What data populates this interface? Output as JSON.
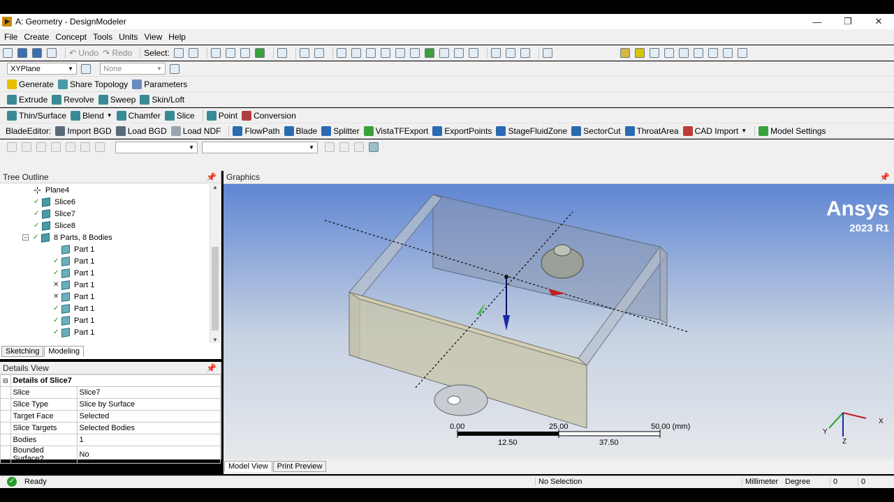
{
  "window": {
    "title": "A: Geometry - DesignModeler",
    "min": "—",
    "restore": "❐",
    "close": "✕"
  },
  "menu": [
    "File",
    "Create",
    "Concept",
    "Tools",
    "Units",
    "View",
    "Help"
  ],
  "toolbar1": {
    "undo": "Undo",
    "redo": "Redo",
    "select": "Select:"
  },
  "toolbar2": {
    "plane": "XYPlane",
    "sketch": "None"
  },
  "toolbar3": {
    "generate": "Generate",
    "share": "Share Topology",
    "params": "Parameters"
  },
  "toolbar4": {
    "extrude": "Extrude",
    "revolve": "Revolve",
    "sweep": "Sweep",
    "skin": "Skin/Loft"
  },
  "toolbar5": {
    "thin": "Thin/Surface",
    "blend": "Blend",
    "chamfer": "Chamfer",
    "slice": "Slice",
    "point": "Point",
    "conversion": "Conversion"
  },
  "toolbar6": {
    "label": "BladeEditor:",
    "items": [
      "Import BGD",
      "Load BGD",
      "Load NDF",
      "FlowPath",
      "Blade",
      "Splitter",
      "VistaTFExport",
      "ExportPoints",
      "StageFluidZone",
      "SectorCut",
      "ThroatArea",
      "CAD Import",
      "Model Settings"
    ]
  },
  "tree": {
    "header": "Tree Outline",
    "items": [
      {
        "label": "Plane4",
        "mark": ""
      },
      {
        "label": "Slice6",
        "mark": "✓"
      },
      {
        "label": "Slice7",
        "mark": "✓"
      },
      {
        "label": "Slice8",
        "mark": "✓"
      },
      {
        "label": "8 Parts, 8 Bodies",
        "mark": "✓"
      },
      {
        "label": "Part 1",
        "mark": ""
      },
      {
        "label": "Part 1",
        "mark": "✓"
      },
      {
        "label": "Part 1",
        "mark": "✓"
      },
      {
        "label": "Part 1",
        "mark": "✕"
      },
      {
        "label": "Part 1",
        "mark": "✕"
      },
      {
        "label": "Part 1",
        "mark": "✓"
      },
      {
        "label": "Part 1",
        "mark": "✓"
      },
      {
        "label": "Part 1",
        "mark": "✓"
      }
    ],
    "tabs": [
      "Sketching",
      "Modeling"
    ]
  },
  "details": {
    "header": "Details View",
    "title": "Details of Slice7",
    "rows": [
      [
        "Slice",
        "Slice7"
      ],
      [
        "Slice Type",
        "Slice by Surface"
      ],
      [
        "Target Face",
        "Selected"
      ],
      [
        "Slice Targets",
        "Selected Bodies"
      ],
      [
        "Bodies",
        "1"
      ],
      [
        "Bounded Surface?",
        "No"
      ]
    ]
  },
  "graphics": {
    "header": "Graphics",
    "brand": "Ansys",
    "version": "2023 R1",
    "scale_top": [
      "0.00",
      "25.00",
      "50.00 (mm)"
    ],
    "scale_bottom": [
      "12.50",
      "37.50"
    ],
    "axes": {
      "x": "X",
      "y": "Y",
      "z": "Z"
    },
    "tabs": [
      "Model View",
      "Print Preview"
    ]
  },
  "status": {
    "state": "Ready",
    "selection": "No Selection",
    "units": "Millimeter",
    "angle": "Degree",
    "v1": "0",
    "v2": "0"
  }
}
